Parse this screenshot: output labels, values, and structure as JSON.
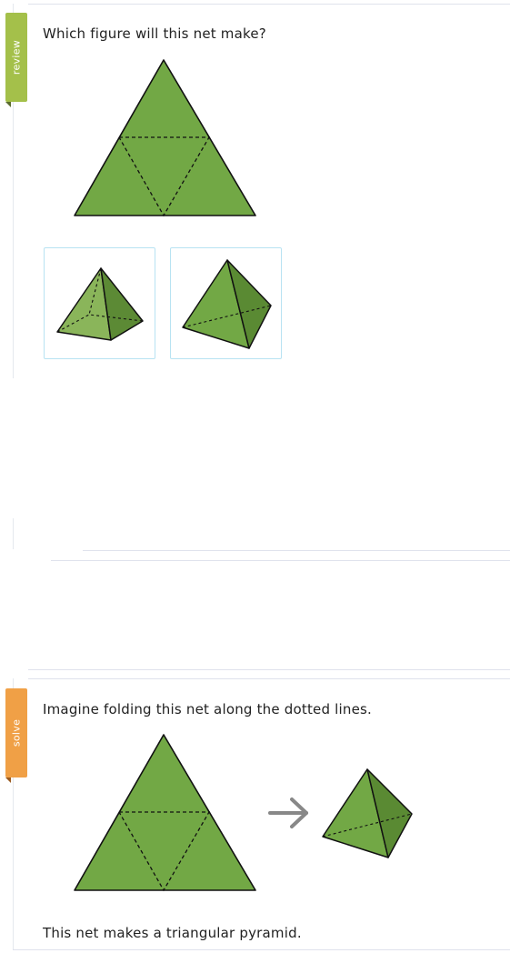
{
  "review": {
    "tab_label": "review",
    "question": "Which figure will this net make?",
    "choices": [
      {
        "id": "square-pyramid",
        "icon": "square-pyramid-icon"
      },
      {
        "id": "triangular-pyramid",
        "icon": "triangular-pyramid-icon"
      }
    ]
  },
  "solve": {
    "tab_label": "solve",
    "instruction": "Imagine folding this net along the dotted lines.",
    "arrow_icon": "arrow-right-icon",
    "conclusion": "This net makes a triangular pyramid."
  },
  "colors": {
    "review_tab": "#a4c04a",
    "solve_tab": "#f0a046",
    "net_fill": "#72a845",
    "choice_border": "#b8e3f2"
  }
}
